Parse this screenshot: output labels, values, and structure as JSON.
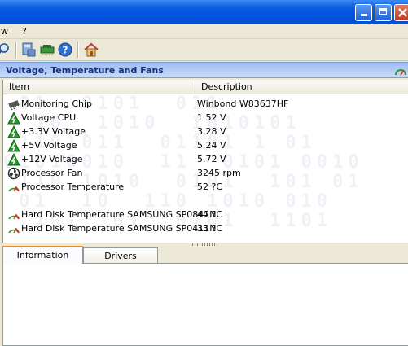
{
  "titlebar": {
    "min_label": "_",
    "max_label": "□",
    "close_label": "×"
  },
  "menu": {
    "items": [
      "w",
      "?"
    ]
  },
  "toolbar": {
    "tools": [
      "search-icon",
      "computer-icon",
      "chip-icon",
      "help-icon",
      "home-icon"
    ]
  },
  "panel": {
    "title": "Voltage, Temperature and Fans"
  },
  "list": {
    "columns": [
      "Item",
      "Description"
    ],
    "rows": [
      {
        "icon": "monitoring-chip-icon",
        "item": "Monitoring Chip",
        "value": "Winbond W83637HF"
      },
      {
        "icon": "voltage-icon",
        "item": "Voltage CPU",
        "value": "1.52 V"
      },
      {
        "icon": "voltage-icon",
        "item": "+3.3V Voltage",
        "value": "3.28 V"
      },
      {
        "icon": "voltage-icon",
        "item": "+5V Voltage",
        "value": "5.24 V"
      },
      {
        "icon": "voltage-icon",
        "item": "+12V Voltage",
        "value": "5.72 V"
      },
      {
        "icon": "fan-icon",
        "item": "Processor Fan",
        "value": "3245 rpm"
      },
      {
        "icon": "temperature-icon",
        "item": "Processor Temperature",
        "value": "52 ?C"
      },
      {
        "icon": "temperature-icon",
        "item": "Hard Disk Temperature SAMSUNG SP0842N",
        "value": "44 ?C"
      },
      {
        "icon": "temperature-icon",
        "item": "Hard Disk Temperature SAMSUNG SP0411N",
        "value": "33 ?C"
      }
    ]
  },
  "tabs": [
    "Information",
    "Drivers"
  ],
  "colors": {
    "title_blue": "#0054e3",
    "accent_orange": "#e68b2c",
    "panel_text": "#15307a"
  }
}
